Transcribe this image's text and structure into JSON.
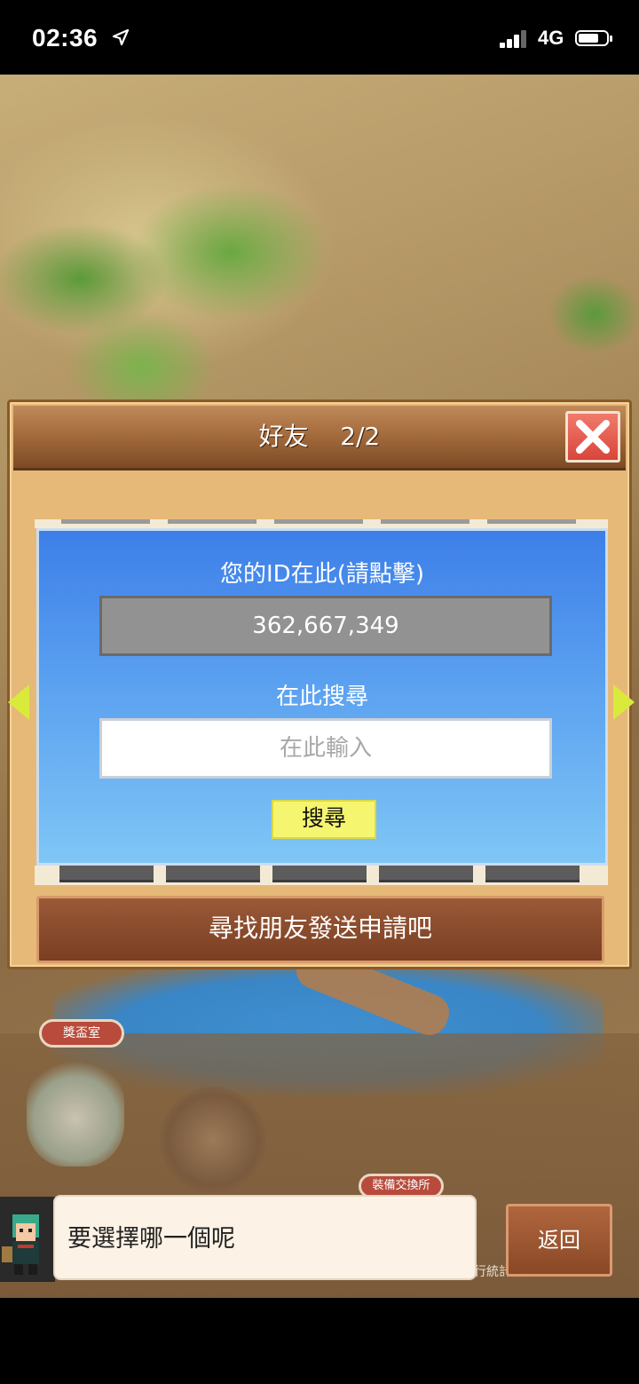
{
  "status_bar": {
    "time": "02:36",
    "network": "4G"
  },
  "scene": {
    "trophy_room_label": "獎盃室",
    "equipment_exchange_label": "裝備交換所",
    "ranking_board_label": "行統計板"
  },
  "friend_dialog": {
    "title": "好友    2/2",
    "id_label": "您的ID在此(請點擊)",
    "id_value": "362,667,349",
    "search_label": "在此搜尋",
    "search_placeholder": "在此輸入",
    "search_button": "搜尋",
    "find_friends_banner": "尋找朋友發送申請吧"
  },
  "bottom": {
    "speech_text": "要選擇哪一個呢",
    "back_button": "返回"
  },
  "colors": {
    "panel_blue": "#3d7fe8",
    "search_button_yellow": "#f6f56f",
    "close_red": "#d9453a",
    "wood_brown": "#7c4a24"
  }
}
